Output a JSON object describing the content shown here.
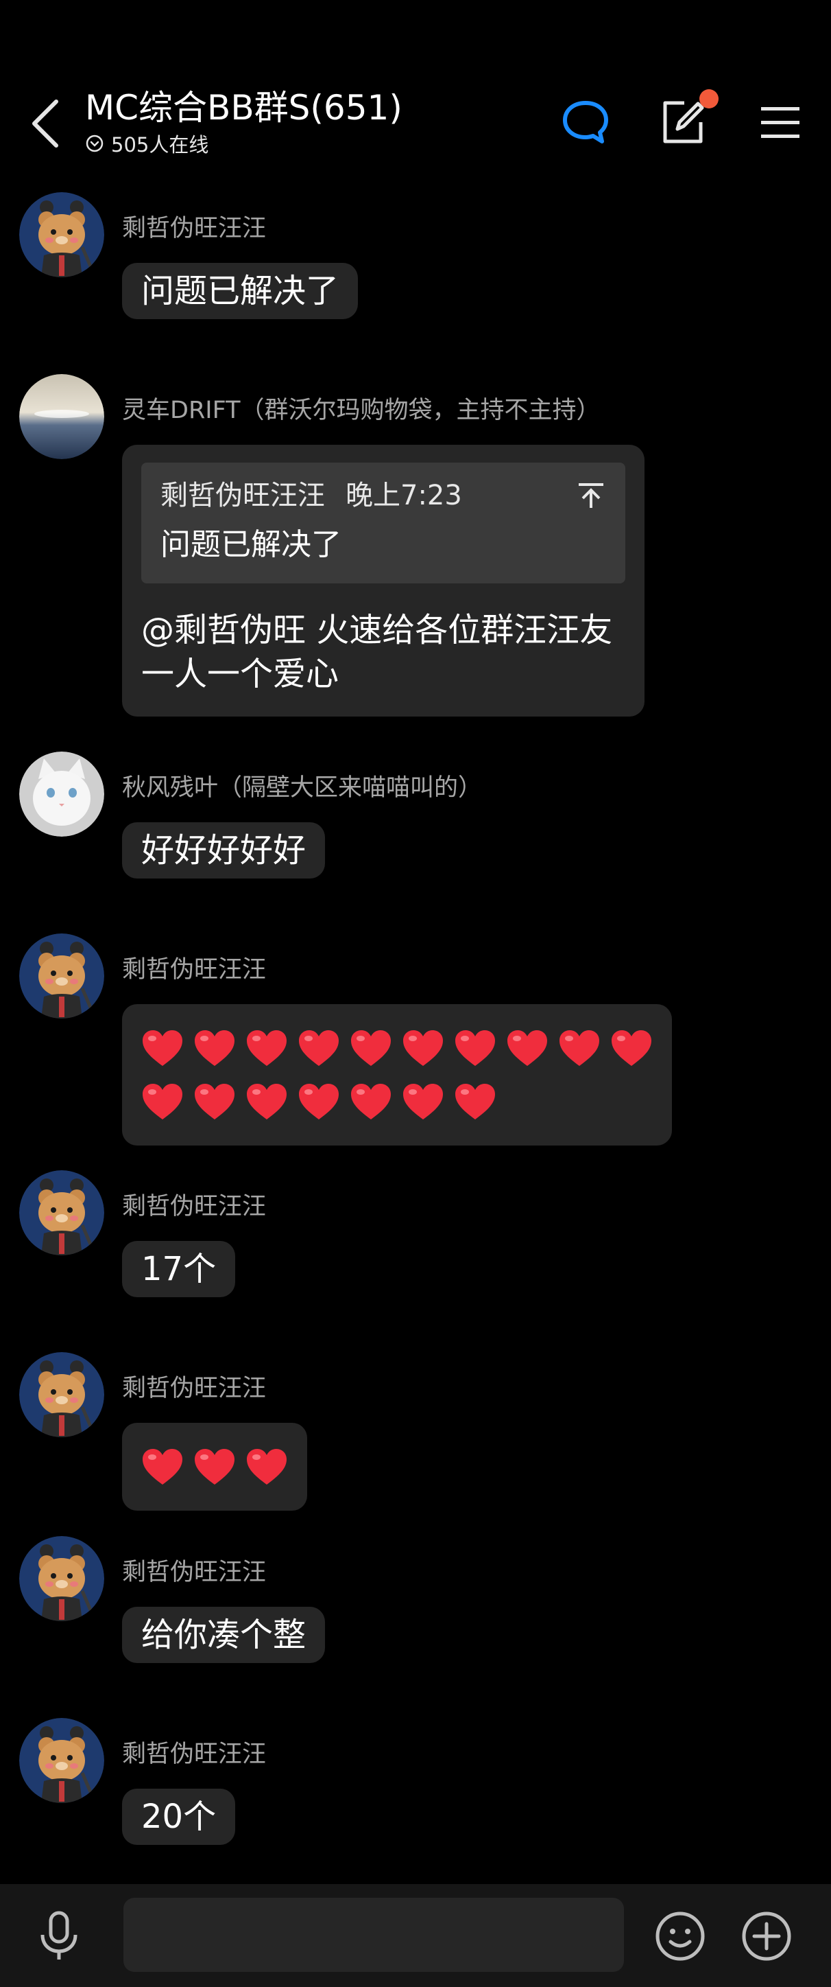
{
  "header": {
    "title": "MC综合BB群S(651)",
    "online": "505人在线"
  },
  "messages": [
    {
      "sender": "剩哲伪旺汪汪",
      "text": "问题已解决了"
    },
    {
      "sender": "灵车DRIFT（群沃尔玛购物袋，主持不主持）",
      "quote": {
        "name": "剩哲伪旺汪汪",
        "time": "晚上7:23",
        "text": "问题已解决了"
      },
      "text": "@剩哲伪旺 火速给各位群汪汪友一人一个爱心"
    },
    {
      "sender": "秋风残叶（隔壁大区来喵喵叫的）",
      "text": "好好好好好"
    },
    {
      "sender": "剩哲伪旺汪汪",
      "heart_count": 17
    },
    {
      "sender": "剩哲伪旺汪汪",
      "text": "17个"
    },
    {
      "sender": "剩哲伪旺汪汪",
      "heart_count": 3
    },
    {
      "sender": "剩哲伪旺汪汪",
      "text": "给你凑个整"
    },
    {
      "sender": "剩哲伪旺汪汪",
      "text": "20个"
    }
  ],
  "input": {
    "placeholder": ""
  },
  "colors": {
    "accent": "#1a8cff",
    "badge": "#f25a3a",
    "bubble": "#262626"
  }
}
